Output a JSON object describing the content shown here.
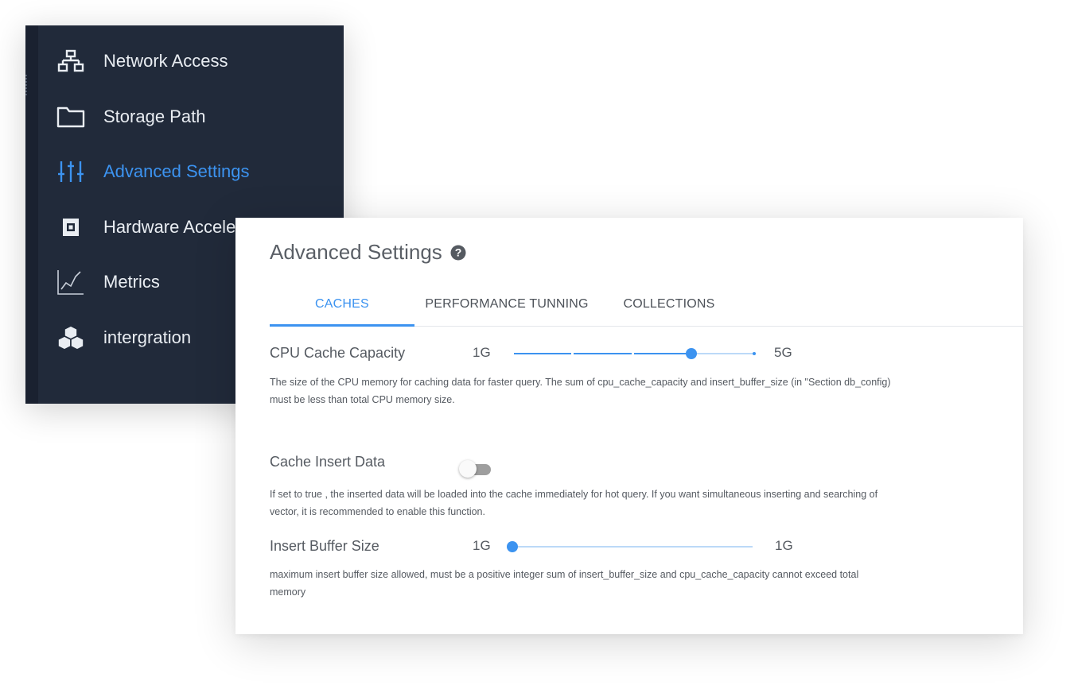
{
  "sidebar": {
    "items": [
      {
        "label": "Network Access",
        "icon": "network-icon",
        "active": false
      },
      {
        "label": "Storage Path",
        "icon": "folder-icon",
        "active": false
      },
      {
        "label": "Advanced Settings",
        "icon": "sliders-icon",
        "active": true
      },
      {
        "label": "Hardware Accele",
        "icon": "chip-icon",
        "active": false
      },
      {
        "label": "Metrics",
        "icon": "chart-line-icon",
        "active": false
      },
      {
        "label": "intergration",
        "icon": "cubes-icon",
        "active": false
      }
    ]
  },
  "panel": {
    "title": "Advanced Settings",
    "help_icon": "question-circle-icon",
    "tabs": [
      {
        "label": "CACHES",
        "active": true
      },
      {
        "label": "PERFORMANCE TUNNING",
        "active": false
      },
      {
        "label": "COLLECTIONS",
        "active": false
      }
    ],
    "cpu_cache": {
      "label": "CPU Cache Capacity",
      "min_label": "1G",
      "max_label": "5G",
      "value_fraction": 0.74,
      "description_line1": "The size of the CPU memory for caching data for faster query. The sum of cpu_cache_capacity and insert_buffer_size (in \"Section db_config)",
      "description_line2": "must be less than total CPU memory size."
    },
    "cache_insert": {
      "label": "Cache Insert Data",
      "enabled": false,
      "description_line1": "If set to true , the inserted data will be loaded into the cache immediately for hot query. If you want simultaneous inserting and searching of",
      "description_line2": "vector, it is recommended to enable this function."
    },
    "insert_buffer": {
      "label": "Insert Buffer Size",
      "min_label": "1G",
      "max_label": "1G",
      "value_fraction": 0.0,
      "description_line1": "maximum insert buffer size allowed, must be a positive integer sum of insert_buffer_size and cpu_cache_capacity cannot exceed total",
      "description_line2": "memory"
    }
  },
  "colors": {
    "sidebar_bg": "#212a3a",
    "accent": "#3c93f0",
    "text": "#555a61"
  }
}
